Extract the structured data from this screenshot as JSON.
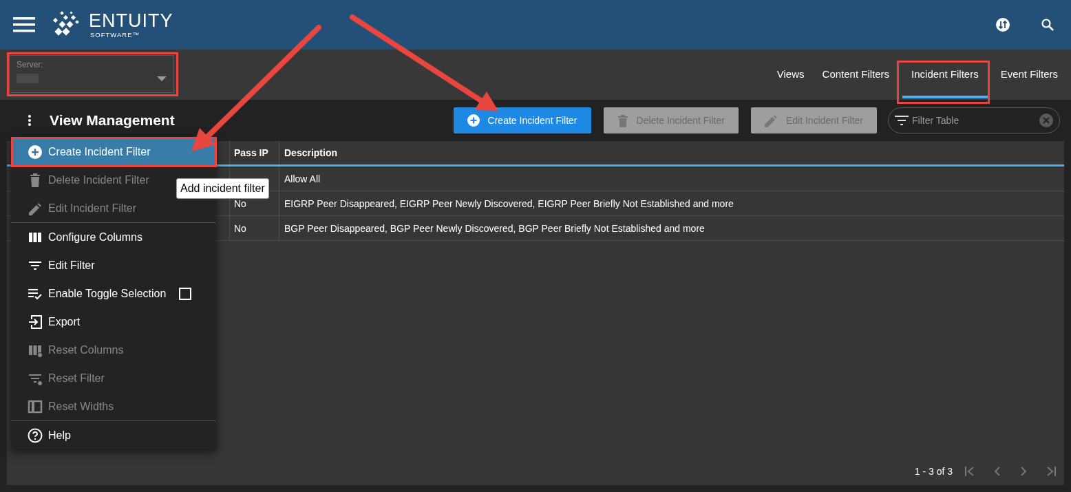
{
  "header": {
    "logo_name": "ENTUITY",
    "logo_sub": "SOFTWARE™"
  },
  "server": {
    "label": "Server:"
  },
  "tabs": [
    {
      "label": "Views",
      "selected": false
    },
    {
      "label": "Content Filters",
      "selected": false
    },
    {
      "label": "Incident Filters",
      "selected": true
    },
    {
      "label": "Event Filters",
      "selected": false
    }
  ],
  "page_title": "View Management",
  "toolbar": {
    "buttons": [
      {
        "label": "Create Incident Filter",
        "disabled": false
      },
      {
        "label": "Delete Incident Filter",
        "disabled": true
      },
      {
        "label": "Edit Incident Filter",
        "disabled": true
      }
    ],
    "filter": {
      "placeholder": "Filter Table"
    }
  },
  "table": {
    "columns": [
      "Pass IP",
      "Description"
    ],
    "rows": [
      {
        "pass_ip": "",
        "description": "Allow All"
      },
      {
        "pass_ip": "No",
        "description": "EIGRP Peer Disappeared, EIGRP Peer Newly Discovered, EIGRP Peer Briefly Not Established and more"
      },
      {
        "pass_ip": "No",
        "description": "BGP Peer Disappeared, BGP Peer Newly Discovered, BGP Peer Briefly Not Established and more"
      }
    ]
  },
  "pagination": {
    "range": "1 - 3 of 3"
  },
  "menu": {
    "groups": [
      [
        {
          "label": "Create Incident Filter",
          "selected": true,
          "disabled": false
        },
        {
          "label": "Delete Incident Filter",
          "selected": false,
          "disabled": true
        },
        {
          "label": "Edit Incident Filter",
          "selected": false,
          "disabled": true
        }
      ],
      [
        {
          "label": "Configure Columns",
          "selected": false,
          "disabled": false
        },
        {
          "label": "Edit Filter",
          "selected": false,
          "disabled": false
        },
        {
          "label": "Enable Toggle Selection",
          "selected": false,
          "disabled": false,
          "kind": "checkbox",
          "checked": false
        },
        {
          "label": "Export",
          "selected": false,
          "disabled": false
        },
        {
          "label": "Reset Columns",
          "selected": false,
          "disabled": true
        },
        {
          "label": "Reset Filter",
          "selected": false,
          "disabled": true
        },
        {
          "label": "Reset Widths",
          "selected": false,
          "disabled": true
        }
      ],
      [
        {
          "label": "Help",
          "selected": false,
          "disabled": false
        }
      ]
    ]
  },
  "tooltip": "Add incident filter"
}
